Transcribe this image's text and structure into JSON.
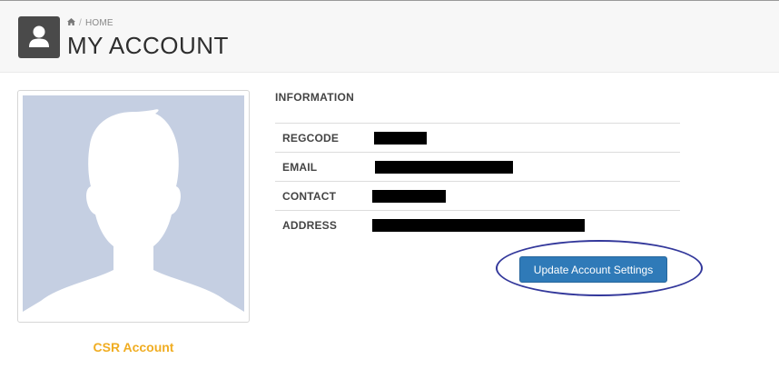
{
  "header": {
    "breadcrumb": {
      "home_icon": "home-icon",
      "separator": "/",
      "label": "HOME"
    },
    "title": "MY ACCOUNT",
    "avatar_icon": "user-icon"
  },
  "profile": {
    "photo_icon": "default-avatar-silhouette",
    "name": "CSR Account"
  },
  "information": {
    "title": "INFORMATION",
    "rows": [
      {
        "label": "REGCODE",
        "value_state": "redacted"
      },
      {
        "label": "EMAIL",
        "value_state": "redacted"
      },
      {
        "label": "CONTACT",
        "value_state": "redacted"
      },
      {
        "label": "ADDRESS",
        "value_state": "redacted"
      }
    ]
  },
  "actions": {
    "update_button": "Update Account Settings"
  },
  "colors": {
    "header_bg": "#f7f7f7",
    "avatar_tile": "#4a4a4a",
    "photo_bg": "#c5cfe2",
    "name_accent": "#f0ad22",
    "button_bg": "#2f7ab8",
    "annotation": "#33389b"
  }
}
